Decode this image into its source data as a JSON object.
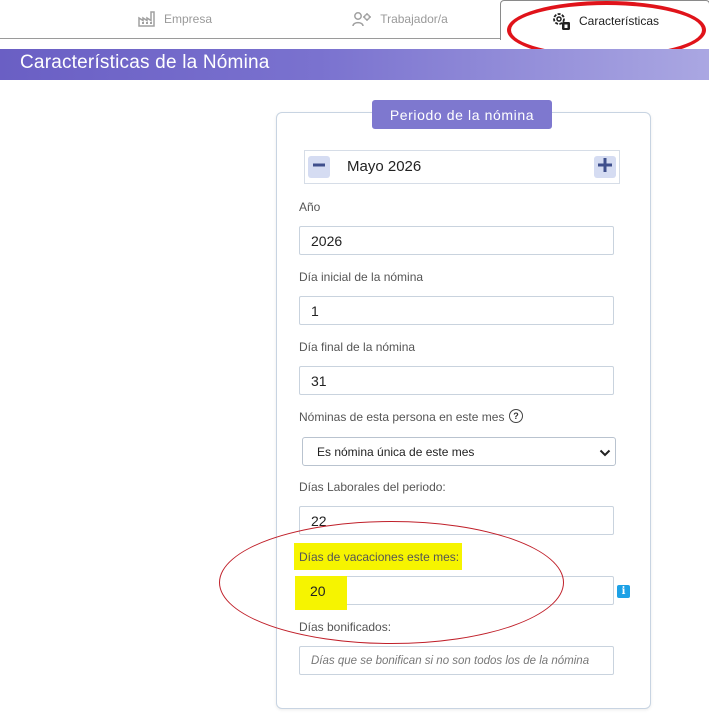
{
  "tabs": {
    "empresa": "Empresa",
    "trabajador": "Trabajador/a",
    "caracteristicas": "Características"
  },
  "header": {
    "title": "Características de la Nómina"
  },
  "period": {
    "legend": "Periodo de la nómina",
    "month_label": "Mayo 2026"
  },
  "fields": {
    "anio": {
      "label": "Año",
      "value": "2026"
    },
    "dia_inicial": {
      "label": "Día inicial de la nómina",
      "value": "1"
    },
    "dia_final": {
      "label": "Día final de la nómina",
      "value": "31"
    },
    "nominas_mes": {
      "label": "Nóminas de esta persona en este mes",
      "selected": "Es nómina única de este mes"
    },
    "dias_laborales": {
      "label": "Días Laborales del periodo:",
      "value": "22"
    },
    "dias_vacaciones": {
      "label": "Días de vacaciones este mes:",
      "value": "20"
    },
    "dias_bonificados": {
      "label": "Días bonificados:",
      "placeholder": "Días que se bonifican si no son todos los de la nómina"
    }
  },
  "colors": {
    "header_band": "#6a5fc4",
    "legend_bg": "#7e78cf",
    "highlight": "#f6f400",
    "annotation": "#e0131a",
    "info_icon": "#1da1e6"
  },
  "icons": [
    "factory-icon",
    "worker-icon",
    "gear-badge-icon",
    "minus-icon",
    "plus-icon",
    "help-circle-icon",
    "info-icon",
    "chevron-down-icon"
  ]
}
